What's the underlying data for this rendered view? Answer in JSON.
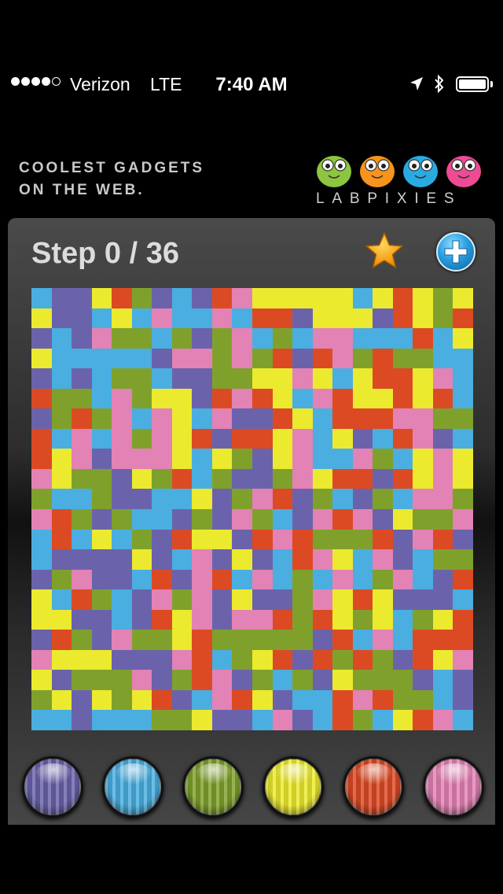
{
  "status_bar": {
    "signal_bars_filled": 4,
    "signal_bars_total": 5,
    "carrier": "Verizon",
    "network": "LTE",
    "time": "7:40 AM",
    "battery_level": 1.0
  },
  "ad_banner": {
    "tagline_line1": "COOLEST GADGETS",
    "tagline_line2": "ON THE WEB.",
    "brand": "LABPIXIES",
    "mascot_colors": [
      "#8cc63f",
      "#f7941d",
      "#29abe2",
      "#ec4c93"
    ]
  },
  "game": {
    "step_label": "Step 0 / 36",
    "steps_taken": 0,
    "steps_max": 36,
    "star_icon": "star-icon",
    "add_icon": "plus-icon"
  },
  "colors": {
    "P": "#6a63ab",
    "B": "#4aaee0",
    "G": "#7fa12c",
    "Y": "#ecea2e",
    "R": "#dc4a24",
    "K": "#e382b4"
  },
  "palette": [
    {
      "name": "purple",
      "key": "P"
    },
    {
      "name": "blue",
      "key": "B"
    },
    {
      "name": "green",
      "key": "G"
    },
    {
      "name": "yellow",
      "key": "Y"
    },
    {
      "name": "red",
      "key": "R"
    },
    {
      "name": "pink",
      "key": "K"
    }
  ],
  "board": {
    "size": 22,
    "rows": [
      "BPPYRGPBPRKYYYYYBYRYGY",
      "YPPBYBKBBKBRRPYYYPRYGR",
      "PBPKGGBGPGKBGBKKBBBRBY",
      "YBBBBBPKKGKGRPRKGRGGBB",
      "PBPBGGBPPGGYYKYBYRRYKB",
      "RGGBKGYYPRKRYBKRYYRYRB",
      "PGRGKBKYBKPPRYBRRRKKGG",
      "RBKBKGKYRPRRYKBYPBRKPB",
      "RYKPKKKYBYGPYKBBKGBYKY",
      "KYGGPYGRBGPPGKYRRPRYKY",
      "GBBGPPBBYPGKRPGBPGBKKG",
      "KRGPGBBPGPKGBPKRKPYGGK",
      "BRBYBGPRYYPRKRGGGRPKRP",
      "BPPPPYPBKPYPBRKYBKPBGG",
      "PGKPPBRPKRBKBGBKBGKBPR",
      "YBRGBPKGKPYPPGKYRYPPPB",
      "YYPPBPRYKPKKRGRYGYBGYR",
      "PRGPKGGYRGGGGGPRBKBRRR",
      "KYYYPPPKRBGYRPRGRGPRYK",
      "YPGGGKPGRKPGBGPYGGGPBP",
      "GYPYGYRPBKRYPBBRKRGGBP",
      "BBPBBBGGYPPBKPBRGBYRKB"
    ]
  }
}
